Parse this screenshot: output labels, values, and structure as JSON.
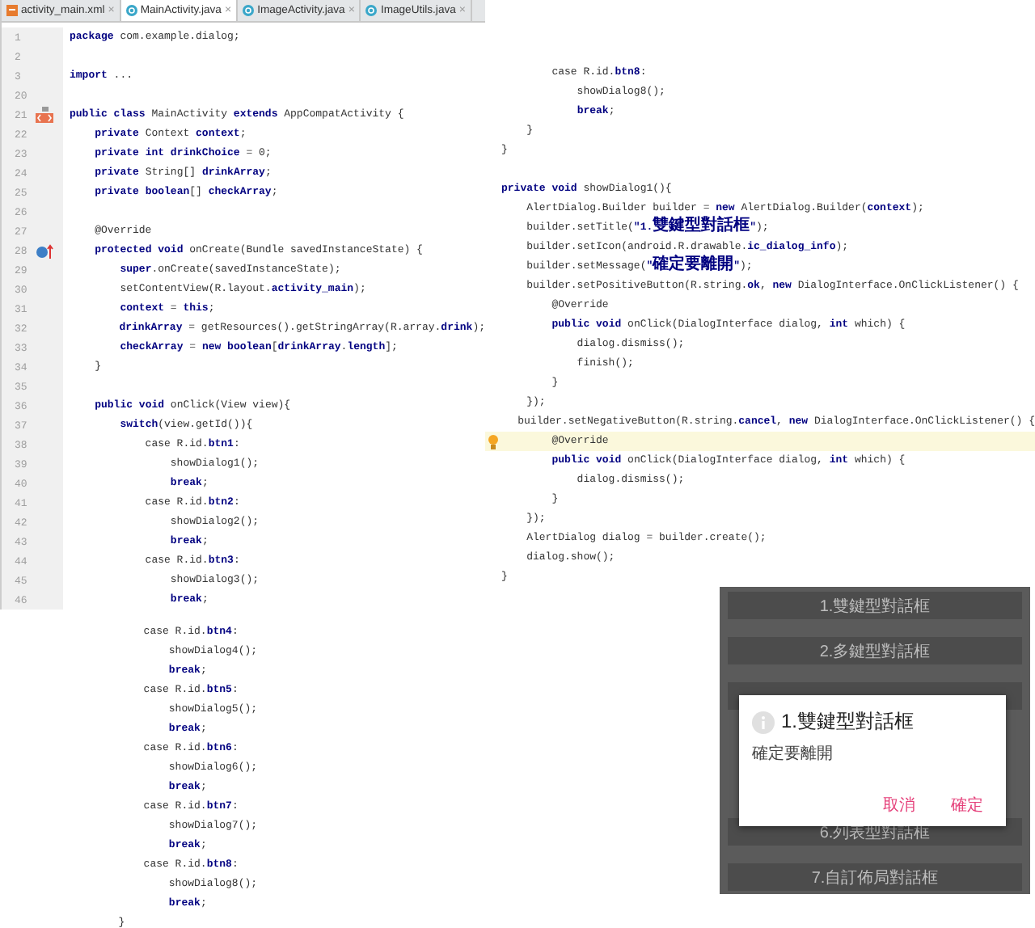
{
  "tabs": [
    {
      "label": "activity_main.xml",
      "kind": "xml",
      "close": "×",
      "selected": false
    },
    {
      "label": "MainActivity.java",
      "kind": "java",
      "close": "×",
      "selected": true
    },
    {
      "label": "ImageActivity.java",
      "kind": "java",
      "close": "×",
      "selected": false
    },
    {
      "label": "ImageUtils.java",
      "kind": "java",
      "close": "×",
      "selected": false
    }
  ],
  "editor": {
    "lines": [
      {
        "number": "1",
        "text": "**package** com.example.dialog;"
      },
      {
        "number": "2"
      },
      {
        "number": "3",
        "text": "**import** ..."
      },
      {
        "number": "20"
      },
      {
        "number": "21",
        "text": "**public class** MainActivity **extends** AppCompatActivity {",
        "kind": "class"
      },
      {
        "number": "22",
        "text": "    **private** Context **context**;"
      },
      {
        "number": "23",
        "text": "    **private int drinkChoice** = 0;"
      },
      {
        "number": "24",
        "text": "    **private** String[] **drinkArray**;"
      },
      {
        "number": "25",
        "text": "    **private boolean**[] **checkArray**;"
      },
      {
        "number": "26"
      },
      {
        "number": "27",
        "text": "    @Override"
      },
      {
        "number": "28",
        "text": "    **protected void** onCreate(Bundle savedInstanceState) {",
        "kind": "override"
      },
      {
        "number": "29",
        "text": "        **super**.onCreate(savedInstanceState);"
      },
      {
        "number": "30",
        "text": "        setContentView(R.layout.**activity_main**);"
      },
      {
        "number": "31",
        "text": "        **context** = **this**;"
      },
      {
        "number": "32",
        "text": "        **drinkArray** = getResources().getStringArray(R.array.**drink**);"
      },
      {
        "number": "33",
        "text": "        **checkArray** = **new boolean**[**drinkArray**.**length**];"
      },
      {
        "number": "34",
        "text": "    }"
      },
      {
        "number": "35"
      },
      {
        "number": "36",
        "text": "    **public void** onClick(View view){"
      },
      {
        "number": "37",
        "text": "        **switch**(view.getId()){"
      },
      {
        "number": "38",
        "text": "            case R.id.**btn1**:"
      },
      {
        "number": "39",
        "text": "                showDialog1();"
      },
      {
        "number": "40",
        "text": "                **break**;"
      },
      {
        "number": "41",
        "text": "            case R.id.**btn2**:"
      },
      {
        "number": "42",
        "text": "                showDialog2();"
      },
      {
        "number": "43",
        "text": "                **break**;"
      },
      {
        "number": "44",
        "text": "            case R.id.**btn3**:"
      },
      {
        "number": "45",
        "text": "                showDialog3();"
      },
      {
        "number": "46",
        "text": "                **break**;"
      }
    ]
  },
  "continuation": [
    "            case R.id.**btn4**:",
    "                showDialog4();",
    "                **break**;",
    "            case R.id.**btn5**:",
    "                showDialog5();",
    "                **break**;",
    "            case R.id.**btn6**:",
    "                showDialog6();",
    "                **break**;",
    "            case R.id.**btn7**:",
    "                showDialog7();",
    "                **break**;",
    "            case R.id.**btn8**:",
    "                showDialog8();",
    "                **break**;",
    "        }"
  ],
  "right_code": [
    {
      "text": "        case R.id.**btn8**:",
      "current": false
    },
    {
      "text": "            showDialog8();",
      "current": false
    },
    {
      "text": "            **break**;",
      "current": false
    },
    {
      "text": "    }",
      "current": false
    },
    {
      "text": "}",
      "current": false
    },
    {
      "current": false
    },
    {
      "text": "**private void** showDialog1(){",
      "current": false
    },
    {
      "text": "    AlertDialog.Builder builder = **new** AlertDialog.Builder(**context**);",
      "current": false
    },
    {
      "text": "    builder.setTitle(**\"1.雙鍵型對話框\"**);",
      "current": false
    },
    {
      "text": "    builder.setIcon(android.R.drawable.**ic_dialog_info**);",
      "current": false
    },
    {
      "text": "    builder.setMessage(**\"確定要離開\"**);",
      "current": false
    },
    {
      "text": "    builder.setPositiveButton(R.string.**ok**, **new** DialogInterface.OnClickListener() {",
      "current": false
    },
    {
      "text": "        @Override",
      "current": false
    },
    {
      "text": "        **public void** onClick(DialogInterface dialog, **int** which) {",
      "current": false
    },
    {
      "text": "            dialog.dismiss();",
      "current": false
    },
    {
      "text": "            finish();",
      "current": false
    },
    {
      "text": "        }",
      "current": false
    },
    {
      "text": "    });",
      "current": false
    },
    {
      "text": "    builder.setNegativeButton(R.string.**cancel**, **new** DialogInterface.OnClickListener() {",
      "current": false
    },
    {
      "text": "        @Override",
      "current": true
    },
    {
      "text": "        **public void** onClick(DialogInterface dialog, **int** which) {",
      "current": false
    },
    {
      "text": "            dialog.dismiss();",
      "current": false
    },
    {
      "text": "        }",
      "current": false
    },
    {
      "text": "    });",
      "current": false
    },
    {
      "text": "    AlertDialog dialog = builder.create();",
      "current": false
    },
    {
      "text": "    dialog.show();",
      "current": false
    },
    {
      "text": "}",
      "current": false
    }
  ],
  "phone": {
    "buttons_above": [
      "1.雙鍵型對話框",
      "2.多鍵型對話框"
    ],
    "buttons_below": [
      "6.列表型對話框",
      "7.自訂佈局對話框"
    ],
    "dialog": {
      "title": "1.雙鍵型對話框",
      "message": "確定要離開",
      "buttons": [
        "取消",
        "確定"
      ]
    }
  }
}
